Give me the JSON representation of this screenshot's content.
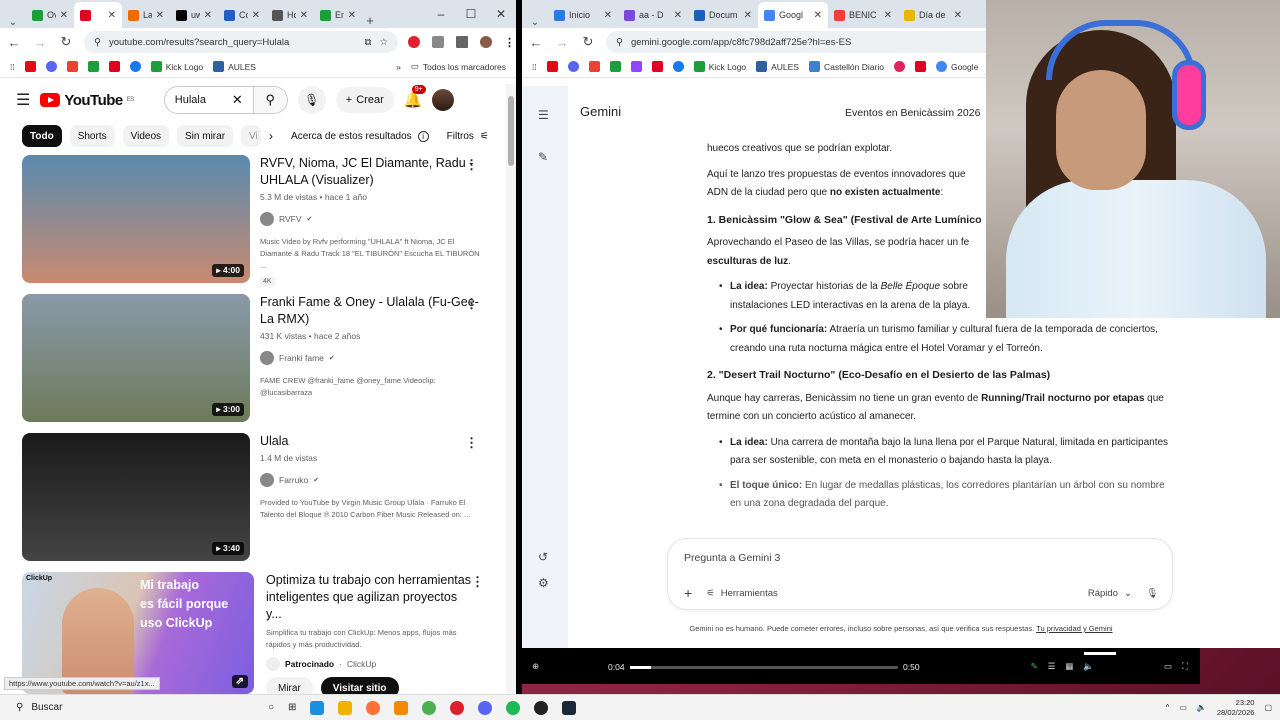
{
  "left_browser": {
    "tabs": [
      {
        "label": "Ove",
        "color": "#1e9e3a"
      },
      {
        "label": "",
        "color": "#e00024",
        "active": true
      },
      {
        "label": "La R",
        "color": "#f06a00"
      },
      {
        "label": "uwu",
        "color": "#000000"
      },
      {
        "label": "Con",
        "color": "#2060c0"
      },
      {
        "label": "How",
        "color": "#555555"
      },
      {
        "label": "Emil",
        "color": "#1e9e3a"
      }
    ],
    "url": "youtube.com/results?search_query=Hulala",
    "bookmarks": [
      {
        "label": "Kick Logo",
        "color": "#1e9e3a"
      },
      {
        "label": "AULES",
        "color": "#3060a0"
      }
    ],
    "bookmarks_folder": "Todos los marcadores"
  },
  "youtube": {
    "logo": "YouTube",
    "logo_region": "ES",
    "search_value": "Hulala",
    "create_label": "Crear",
    "notif_badge": "9+",
    "chips": [
      "Todo",
      "Shorts",
      "Videos",
      "Sin mirar",
      "Vi"
    ],
    "about_results": "Acerca de estos resultados",
    "filters": "Filtros",
    "videos": [
      {
        "title": "RVFV, Nioma, JC El Diamante, Radu - UHLALA (Visualizer)",
        "meta": "5.3 M de vistas • hace 1 año",
        "channel": "RVFV",
        "description": "Music Video by Rvfv performing \"UHLALA\" ft Nioma, JC El Diamante & Radu Track 18 \"EL TIBURÓN\" Escucha EL TIBURÓN ...",
        "tag": "4K",
        "duration": "4:00",
        "thumb_colors": [
          "#5a8ab0",
          "#c98a70"
        ]
      },
      {
        "title": "Franki Fame & Oney - Ulalala (Fu-Gee-La RMX)",
        "meta": "431 K vistas • hace 2 años",
        "channel": "Franki fame",
        "description": "FAME CREW @franki_fame @oney_fame Videoclip: @lucasibarraza",
        "tag": "",
        "duration": "3:00",
        "thumb_colors": [
          "#8a9aa8",
          "#6d7a5a"
        ]
      },
      {
        "title": "Ulala",
        "meta": "1.4 M de vistas",
        "channel": "Farruko",
        "description": "Provided to YouTube by Virgin Music Group Ulala · Farruko El Talento del Bloque ℗ 2010 Carbon Fiber Music Released on: ...",
        "tag": "",
        "duration": "3:40",
        "thumb_colors": [
          "#1a1a1a",
          "#444444"
        ]
      }
    ],
    "ad": {
      "brand": "ClickUp",
      "thumb_text_lines": [
        "Mi trabajo",
        "es fácil porque",
        "uso ClickUp"
      ],
      "title": "Optimiza tu trabajo con herramientas inteligentes que agilizan proyectos y...",
      "description": "Simplifica tu trabajo con ClickUp: Menos apps, flujos más rápidos y más productividad.",
      "sponsor": "Patrocinado",
      "sponsor_brand": "ClickUp",
      "watch": "Mirar",
      "visit": "Visitar sitio"
    },
    "status_url": "https://www.youtube.com/watch?v=au/z1x..."
  },
  "right_browser": {
    "tabs": [
      {
        "label": "Inicio",
        "color": "#2a7ae2"
      },
      {
        "label": "aa - D",
        "color": "#7a4bd8"
      },
      {
        "label": "Docum",
        "color": "#1a5fb4"
      },
      {
        "label": "Googl",
        "color": "#4285f4",
        "active": true
      },
      {
        "label": "BENIC",
        "color": "#ea4335"
      },
      {
        "label": "Día de",
        "color": "#e6b800"
      }
    ],
    "url": "gemini.google.com/app/c8fc798d2aff725e?hl=es-ES",
    "bookmarks": [
      {
        "label": "Kick Logo",
        "color": "#1e9e3a"
      },
      {
        "label": "AULES",
        "color": "#3060a0"
      },
      {
        "label": "Castellón Diario",
        "color": "#3d7fd0"
      },
      {
        "label": "Google",
        "color": "#4285f4"
      }
    ]
  },
  "gemini": {
    "app_title": "Gemini",
    "conversation_title": "Eventos en Benicàssim 2026",
    "para1": "huecos creativos que se podrían explotar.",
    "para2_a": "Aquí te lanzo tres propuestas de eventos innovadores que",
    "para2_b": "ADN de la ciudad pero que ",
    "para2_bold": "no existen actualmente",
    "para2_end": ":",
    "h1": "1. Benicàssim \"Glow & Sea\" (Festival de Arte Lumínico",
    "p3_a": "Aprovechando el Paseo de las Villas, se podría hacer un fe",
    "p3_bold": "esculturas de luz",
    "p3_end": ".",
    "b1_label": "La idea:",
    "b1_text_a": " Proyectar historias de la ",
    "b1_italic": "Belle Époque",
    "b1_text_b": " sobre",
    "b1_text_c": "instalaciones LED interactivas en la arena de la playa.",
    "b2_label": "Por qué funcionaría:",
    "b2_text": " Atraería un turismo familiar y cultural fuera de la temporada de conciertos, creando una ruta nocturna mágica entre el Hotel Voramar y el Torreón.",
    "h2": "2. \"Desert Trail Nocturno\" (Eco-Desafío en el Desierto de las Palmas)",
    "p4_a": "Aunque hay carreras, Benicàssim no tiene un gran evento de ",
    "p4_bold": "Running/Trail nocturno por etapas",
    "p4_end": " que termine con un concierto acústico al amanecer.",
    "b3_label": "La idea:",
    "b3_text": " Una carrera de montaña bajo la luna llena por el Parque Natural, limitada en participantes para ser sostenible, con meta en el monasterio o bajando hasta la playa.",
    "b4_label": "El toque único:",
    "b4_text": " En lugar de medallas plásticas, los corredores plantarían un árbol con su nombre en una zona degradada del parque.",
    "prompt_placeholder": "Pregunta a Gemini 3",
    "tools": "Herramientas",
    "mode": "Rápido",
    "disclaimer": "Gemini no es humano. Puede cometer errores, incluso sobre personas, así que verifica sus respuestas. ",
    "privacy_link": "Tu privacidad y Gemini"
  },
  "player": {
    "current": "0:04",
    "total": "0:50",
    "progress": 0.08
  },
  "taskbar": {
    "search": "Buscar",
    "time": "23:20",
    "date": "28/02/2026"
  }
}
